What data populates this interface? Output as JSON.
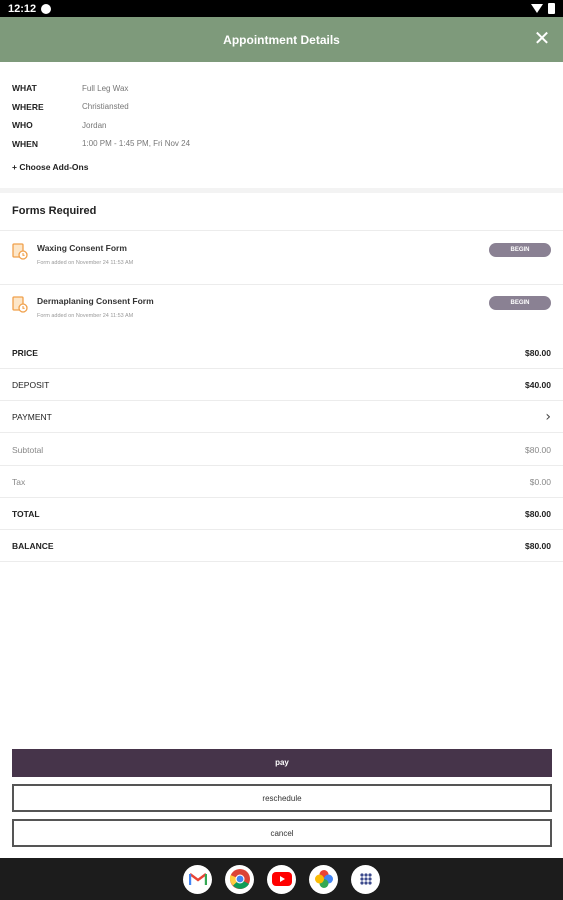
{
  "status_bar": {
    "time": "12:12"
  },
  "header": {
    "title": "Appointment Details",
    "close_icon": "close-icon"
  },
  "details": {
    "what_label": "WHAT",
    "what_value": "Full Leg Wax",
    "where_label": "WHERE",
    "where_value": "Christiansted",
    "who_label": "WHO",
    "who_value": "Jordan",
    "when_label": "WHEN",
    "when_value": "1:00 PM - 1:45 PM, Fri Nov 24",
    "addons_label": "+ Choose Add-Ons"
  },
  "forms": {
    "title": "Forms Required",
    "items": [
      {
        "name": "Waxing Consent Form",
        "sub": "Form added on November 24 11:53 AM",
        "action": "BEGIN"
      },
      {
        "name": "Dermaplaning Consent Form",
        "sub": "Form added on November 24 11:53 AM",
        "action": "BEGIN"
      }
    ]
  },
  "pricing": {
    "price_label": "PRICE",
    "price_value": "$80.00",
    "deposit_label": "DEPOSIT",
    "deposit_value": "$40.00",
    "payment_label": "PAYMENT",
    "subtotal_label": "Subtotal",
    "subtotal_value": "$80.00",
    "tax_label": "Tax",
    "tax_value": "$0.00",
    "total_label": "TOTAL",
    "total_value": "$80.00",
    "balance_label": "BALANCE",
    "balance_value": "$80.00"
  },
  "actions": {
    "pay": "pay",
    "reschedule": "reschedule",
    "cancel": "cancel"
  },
  "colors": {
    "header": "#7e9a7b",
    "primary_button": "#46344a",
    "begin_badge": "#8a8193",
    "form_icon": "#f0a04b"
  },
  "dock_apps": [
    "gmail-icon",
    "chrome-icon",
    "youtube-icon",
    "photos-icon",
    "app-drawer-icon"
  ]
}
